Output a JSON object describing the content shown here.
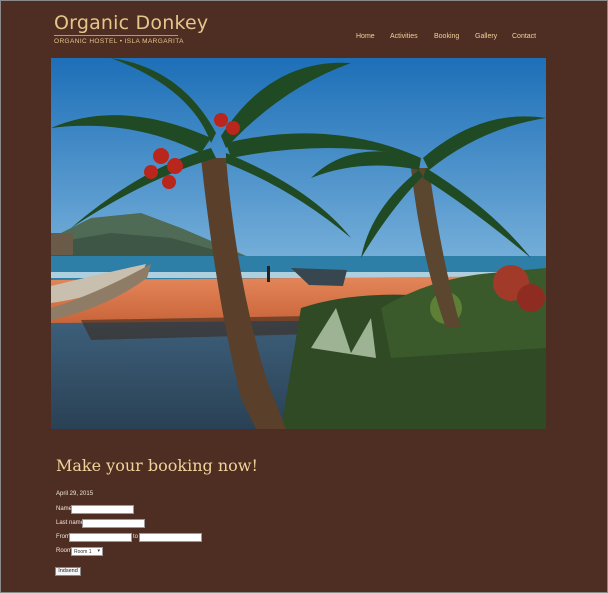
{
  "brand": {
    "title": "Organic Donkey",
    "subtitle": "ORGANIC HOSTEL • ISLA MARGARITA"
  },
  "nav": {
    "items": [
      {
        "label": "Home"
      },
      {
        "label": "Activities"
      },
      {
        "label": "Booking"
      },
      {
        "label": "Gallery"
      },
      {
        "label": "Contact"
      }
    ]
  },
  "hero": {
    "icon": "beach-photo"
  },
  "booking": {
    "heading": "Make your booking now!",
    "date": "April 29, 2015",
    "name_label": "Name",
    "name_value": "",
    "lastname_label": "Last name",
    "lastname_value": "",
    "from_label": "From",
    "from_value": "",
    "to_label": "to",
    "to_value": "",
    "room_label": "Room",
    "room_selected": "Room 1",
    "submit_label": "Indsend"
  },
  "colors": {
    "background": "#4e2e23",
    "accent": "#f0d39a"
  }
}
